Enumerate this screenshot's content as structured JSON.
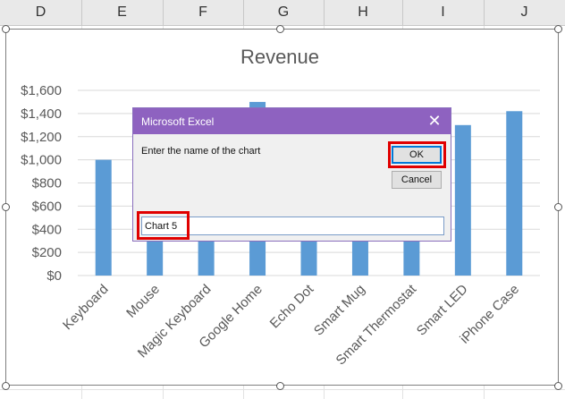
{
  "columns": [
    "D",
    "E",
    "F",
    "G",
    "H",
    "I",
    "J"
  ],
  "dialog": {
    "title": "Microsoft Excel",
    "close_glyph": "✕",
    "prompt": "Enter the name of the chart",
    "ok_label": "OK",
    "cancel_label": "Cancel",
    "input_value": "Chart 5"
  },
  "colors": {
    "bar": "#5b9bd5",
    "dialog_title": "#8e62c0",
    "highlight": "#e00000"
  },
  "chart_data": {
    "type": "bar",
    "title": "Revenue",
    "categories": [
      "Keyboard",
      "Mouse",
      "Magic Keyboard",
      "Google Home",
      "Echo Dot",
      "Smart Mug",
      "Smart Thermostat",
      "Smart LED",
      "iPhone Case"
    ],
    "values": [
      1000,
      950,
      1050,
      1500,
      1100,
      1000,
      1200,
      1300,
      1420
    ],
    "yticks": [
      "$0",
      "$200",
      "$400",
      "$600",
      "$800",
      "$1,000",
      "$1,200",
      "$1,400",
      "$1,600"
    ],
    "ylim": [
      0,
      1600
    ],
    "grid": true,
    "legend": "none"
  }
}
